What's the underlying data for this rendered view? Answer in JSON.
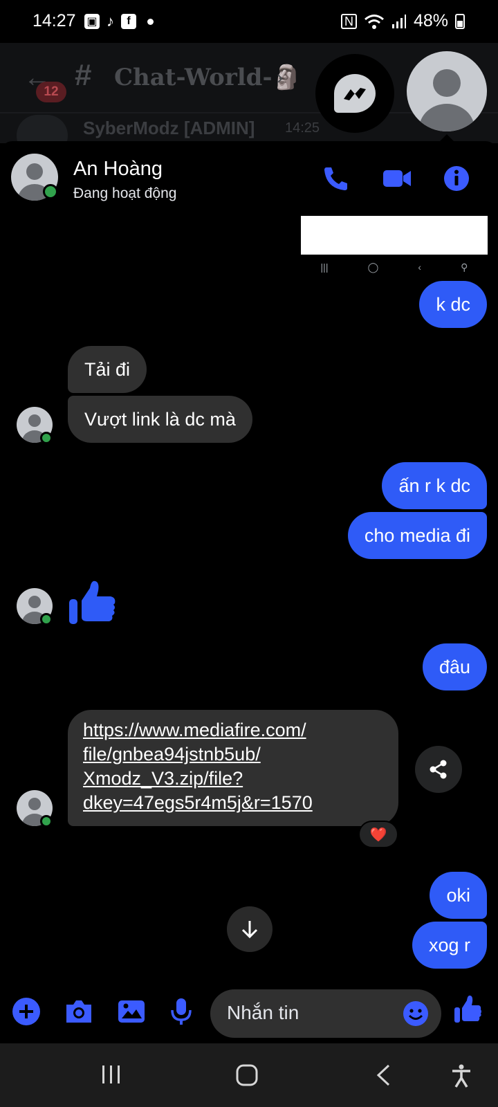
{
  "status_bar": {
    "time": "14:27",
    "battery": "48%",
    "icons": [
      "gallery-icon",
      "tiktok-icon",
      "facebook-icon",
      "dot-icon",
      "nfc-icon",
      "wifi-icon",
      "signal-icon",
      "battery-icon"
    ]
  },
  "background_app": {
    "badge_count": "12",
    "channel_name": "Chat-World-🗿",
    "last_user": "SyberModz [ADMIN]",
    "last_time": "14:25"
  },
  "chat": {
    "contact_name": "An Hoàng",
    "contact_status": "Đang hoạt động",
    "mini_nav": [
      "|||",
      "◯",
      "‹",
      "⚲"
    ],
    "messages": [
      {
        "dir": "out",
        "text": "k dc"
      },
      {
        "dir": "in",
        "text": "Tải đi"
      },
      {
        "dir": "in",
        "text": "Vượt link là dc mà"
      },
      {
        "dir": "out",
        "text": "ấn r k dc"
      },
      {
        "dir": "out",
        "text": "cho media đi"
      },
      {
        "dir": "in",
        "text": "👍",
        "type": "like"
      },
      {
        "dir": "out",
        "text": "đâu"
      },
      {
        "dir": "in",
        "type": "link",
        "lines": [
          "https://www.mediafire.com/",
          "file/gnbea94jstnb5ub/",
          "Xmodz_V3.zip/file?",
          "dkey=47egs5r4m5j&r=1570"
        ],
        "reaction": "❤️"
      },
      {
        "dir": "out",
        "text": "oki"
      },
      {
        "dir": "out",
        "text": "xog r"
      }
    ]
  },
  "composer": {
    "placeholder": "Nhắn tin"
  },
  "colors": {
    "accent": "#2f5bf7",
    "icon_blue": "#3b5bff",
    "incoming_bubble": "#303030",
    "online": "#31a24c"
  }
}
